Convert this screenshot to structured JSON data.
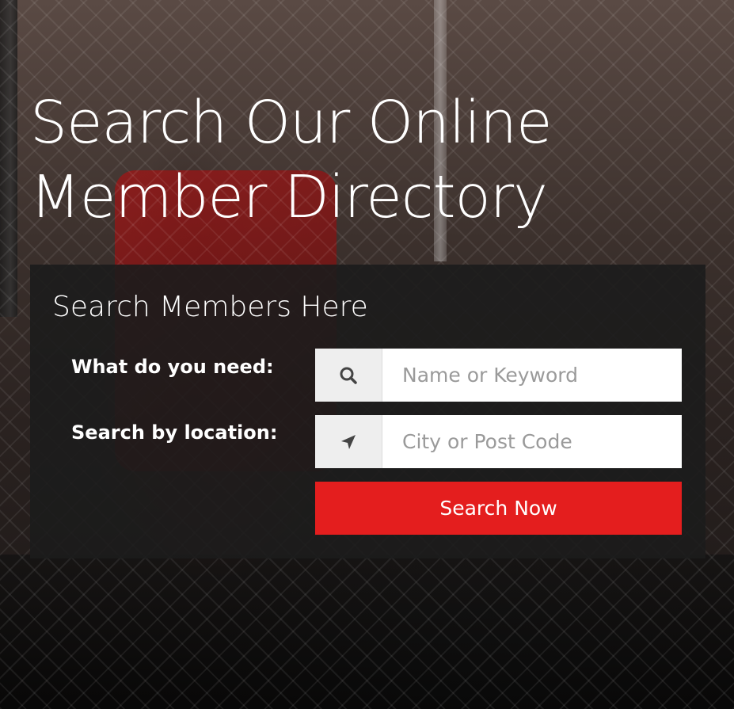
{
  "hero": {
    "title_line1": "Search Our Online",
    "title_line2": "Member Directory"
  },
  "search_panel": {
    "title": "Search Members Here",
    "keyword": {
      "label": "What do you need:",
      "icon": "search-icon",
      "value": "",
      "placeholder": "Name or Keyword"
    },
    "location": {
      "label": "Search by location:",
      "icon": "location-arrow-icon",
      "value": "",
      "placeholder": "City or Post Code"
    },
    "submit_label": "Search Now"
  },
  "colors": {
    "accent": "#e41e1e",
    "panel_bg": "#1c1c1c",
    "addon_bg": "#eeeeee",
    "text_light": "#ffffff",
    "placeholder": "#9a9a9a"
  }
}
